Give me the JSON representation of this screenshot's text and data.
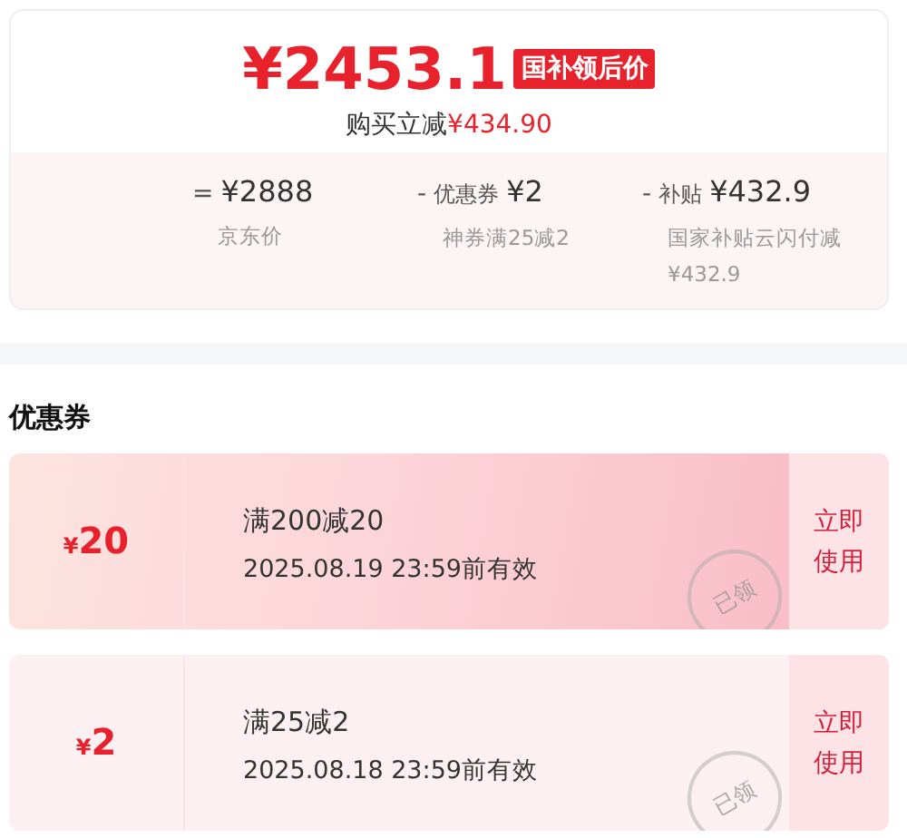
{
  "price_card": {
    "price": "¥2453.1",
    "price_badge": "国补领后价",
    "discount_label": "购买立减",
    "discount_amount": "¥434.90",
    "breakdown": [
      {
        "operator": "=",
        "amount": "¥2888",
        "note": "京东价"
      },
      {
        "operator": "-",
        "label": "优惠券",
        "amount": "¥2",
        "note": "神券满25减2"
      },
      {
        "operator": "-",
        "label": "补贴",
        "amount": "¥432.9",
        "note": "国家补贴云闪付减¥432.9"
      }
    ]
  },
  "coupons_section": {
    "title": "优惠券",
    "coupons": [
      {
        "kind": "featured",
        "amount": "20",
        "currency": "¥",
        "condition": "满200减20",
        "validity": "2025.08.19 23:59前有效",
        "stamp": "已领",
        "action": "立即使用"
      },
      {
        "kind": "plain",
        "amount": "2",
        "currency": "¥",
        "condition": "满25减2",
        "validity": "2025.08.18 23:59前有效",
        "stamp": "已领",
        "action": "立即使用"
      }
    ]
  }
}
